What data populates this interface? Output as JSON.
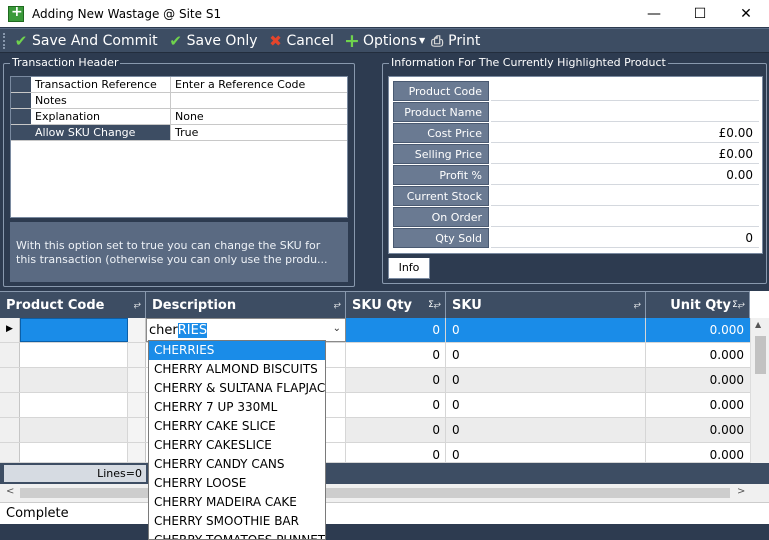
{
  "window": {
    "title": "Adding New Wastage @ Site S1"
  },
  "toolbar": {
    "save_commit_label": "Save And Commit",
    "save_only_label": "Save Only",
    "cancel_label": "Cancel",
    "options_label": "Options",
    "print_label": "Print"
  },
  "transaction_header": {
    "group_title": "Transaction Header",
    "rows": [
      {
        "label": "Transaction Reference",
        "value": "Enter a Reference Code"
      },
      {
        "label": "Notes",
        "value": ""
      },
      {
        "label": "Explanation",
        "value": "None"
      },
      {
        "label": "Allow SKU Change",
        "value": "True"
      }
    ],
    "help_text": "With this option set to true you can change the SKU for this transaction (otherwise you can only use the produ..."
  },
  "info_panel": {
    "group_title": "Information For The Currently Highlighted Product",
    "rows": [
      {
        "label": "Product Code",
        "value": ""
      },
      {
        "label": "Product Name",
        "value": ""
      },
      {
        "label": "Cost Price",
        "value": "£0.00"
      },
      {
        "label": "Selling Price",
        "value": "£0.00"
      },
      {
        "label": "Profit %",
        "value": "0.00"
      },
      {
        "label": "Current Stock",
        "value": ""
      },
      {
        "label": "On Order",
        "value": ""
      },
      {
        "label": "Qty Sold",
        "value": "0"
      }
    ],
    "tab_label": "Info"
  },
  "grid": {
    "columns": [
      "Product Code",
      "Description",
      "SKU Qty",
      "SKU",
      "Unit Qty"
    ],
    "editor": {
      "typed": "cher",
      "autocomplete": "RIES"
    },
    "rows": [
      {
        "sku_qty": "0",
        "sku": "0",
        "unit_qty": "0.000"
      },
      {
        "sku_qty": "0",
        "sku": "0",
        "unit_qty": "0.000"
      },
      {
        "sku_qty": "0",
        "sku": "0",
        "unit_qty": "0.000"
      },
      {
        "sku_qty": "0",
        "sku": "0",
        "unit_qty": "0.000"
      },
      {
        "sku_qty": "0",
        "sku": "0",
        "unit_qty": "0.000"
      },
      {
        "sku_qty": "0",
        "sku": "0",
        "unit_qty": "0.000"
      }
    ],
    "lines_label": "Lines=0"
  },
  "dropdown": {
    "items": [
      "CHERRIES",
      "CHERRY  ALMOND BISCUITS",
      "CHERRY & SULTANA FLAPJACK",
      "CHERRY 7 UP 330ML",
      "CHERRY CAKE SLICE",
      "CHERRY CAKESLICE",
      "CHERRY CANDY CANS",
      "CHERRY LOOSE",
      "CHERRY MADEIRA CAKE",
      "CHERRY SMOOTHIE BAR",
      "CHERRY TOMATOES PUNNET OF"
    ]
  },
  "status": {
    "text": "Complete"
  }
}
